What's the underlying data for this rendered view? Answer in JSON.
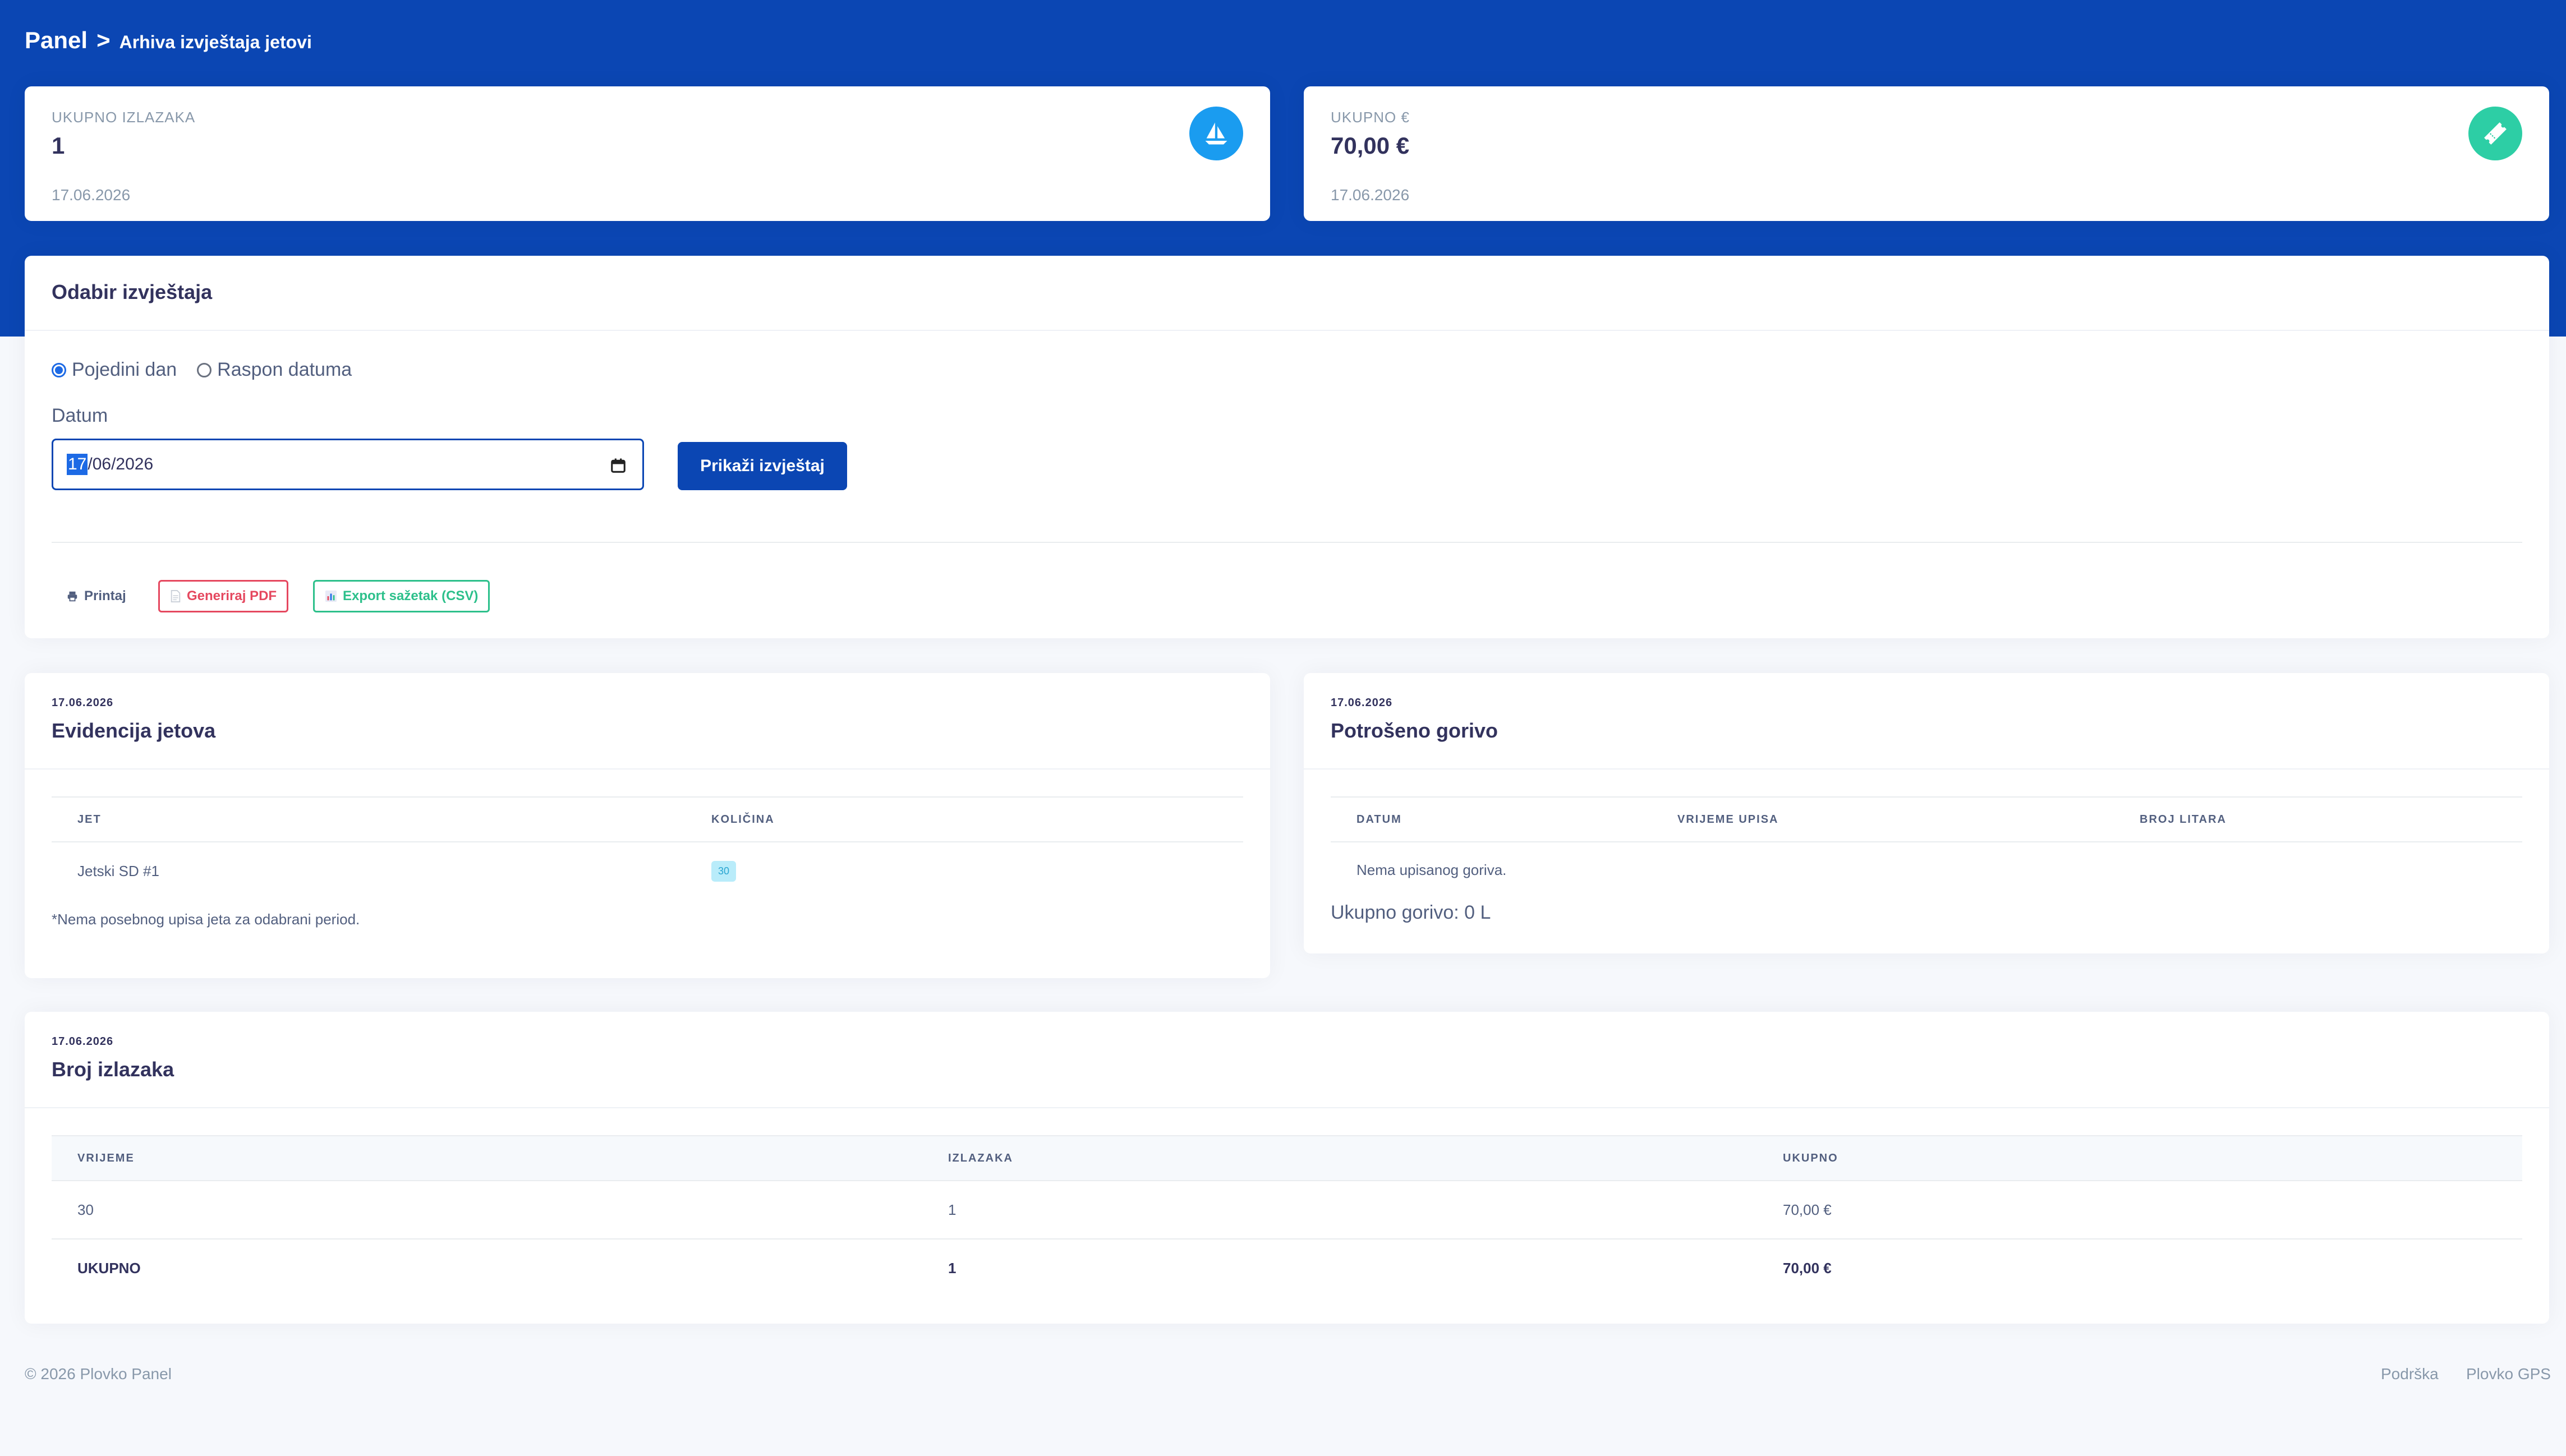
{
  "breadcrumb": {
    "root": "Panel",
    "separator": ">",
    "current": "Arhiva izvještaja jetovi"
  },
  "stats": [
    {
      "label": "UKUPNO IZLAZAKA",
      "value": "1",
      "date": "17.06.2026",
      "icon": "sailboat-icon",
      "color": "#1a9cf0"
    },
    {
      "label": "UKUPNO €",
      "value": "70,00 €",
      "date": "17.06.2026",
      "icon": "ticket-icon",
      "color": "#2dcea5"
    }
  ],
  "report_select": {
    "title": "Odabir izvještaja",
    "radios": [
      {
        "label": "Pojedini dan",
        "checked": true
      },
      {
        "label": "Raspon datuma",
        "checked": false
      }
    ],
    "date_label": "Datum",
    "date_selected_part": "17",
    "date_rest": "/06/2026",
    "show_button": "Prikaži izvještaj",
    "tools": {
      "print": "Printaj",
      "pdf": "Generiraj PDF",
      "csv": "Export sažetak (CSV)"
    }
  },
  "jets": {
    "date": "17.06.2026",
    "title": "Evidencija jetova",
    "columns": [
      "JET",
      "KOLIČINA"
    ],
    "rows": [
      {
        "jet": "Jetski SD #1",
        "qty": "30"
      }
    ],
    "note": "*Nema posebnog upisa jeta za odabrani period."
  },
  "fuel": {
    "date": "17.06.2026",
    "title": "Potrošeno gorivo",
    "columns": [
      "DATUM",
      "VRIJEME UPISA",
      "BROJ LITARA"
    ],
    "empty": "Nema upisanog goriva.",
    "total": "Ukupno gorivo: 0 L"
  },
  "trips": {
    "date": "17.06.2026",
    "title": "Broj izlazaka",
    "columns": [
      "VRIJEME",
      "IZLAZAKA",
      "UKUPNO"
    ],
    "rows": [
      [
        "30",
        "1",
        "70,00 €"
      ],
      [
        "UKUPNO",
        "1",
        "70,00 €"
      ]
    ]
  },
  "footer": {
    "copyright": "© 2026 Plovko Panel",
    "links": [
      "Podrška",
      "Plovko GPS"
    ]
  }
}
